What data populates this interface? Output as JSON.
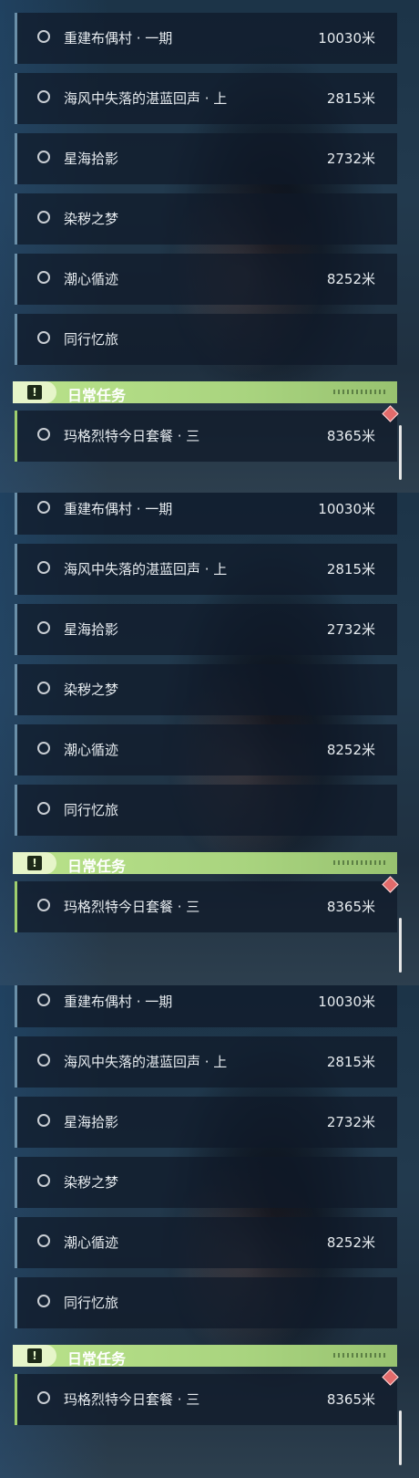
{
  "panels": [
    {
      "quests": [
        {
          "name": "重建布偶村 · 一期",
          "distance": "10030米"
        },
        {
          "name": "海风中失落的湛蓝回声 · 上",
          "distance": "2815米"
        },
        {
          "name": "星海拾影",
          "distance": "2732米"
        },
        {
          "name": "染秽之梦",
          "distance": ""
        },
        {
          "name": "潮心循迹",
          "distance": "8252米"
        },
        {
          "name": "同行忆旅",
          "distance": ""
        }
      ],
      "category": {
        "title": "日常任务",
        "badge_icon": "exclamation-icon"
      },
      "daily": {
        "name": "玛格烈特今日套餐 · 三",
        "distance": "8365米"
      }
    },
    {
      "quests": [
        {
          "name": "重建布偶村 · 一期",
          "distance": "10030米"
        },
        {
          "name": "海风中失落的湛蓝回声 · 上",
          "distance": "2815米"
        },
        {
          "name": "星海拾影",
          "distance": "2732米"
        },
        {
          "name": "染秽之梦",
          "distance": ""
        },
        {
          "name": "潮心循迹",
          "distance": "8252米"
        },
        {
          "name": "同行忆旅",
          "distance": ""
        }
      ],
      "category": {
        "title": "日常任务",
        "badge_icon": "exclamation-icon"
      },
      "daily": {
        "name": "玛格烈特今日套餐 · 三",
        "distance": "8365米"
      }
    },
    {
      "quests": [
        {
          "name": "重建布偶村 · 一期",
          "distance": "10030米"
        },
        {
          "name": "海风中失落的湛蓝回声 · 上",
          "distance": "2815米"
        },
        {
          "name": "星海拾影",
          "distance": "2732米"
        },
        {
          "name": "染秽之梦",
          "distance": ""
        },
        {
          "name": "潮心循迹",
          "distance": "8252米"
        },
        {
          "name": "同行忆旅",
          "distance": ""
        }
      ],
      "category": {
        "title": "日常任务",
        "badge_icon": "exclamation-icon"
      },
      "daily": {
        "name": "玛格烈特今日套餐 · 三",
        "distance": "8365米"
      }
    }
  ],
  "colors": {
    "category_bar": "#b9e28a",
    "daily_accent": "#9ecf6e",
    "quest_accent": "#6a8fa8",
    "alert_marker": "#e26b6b"
  }
}
